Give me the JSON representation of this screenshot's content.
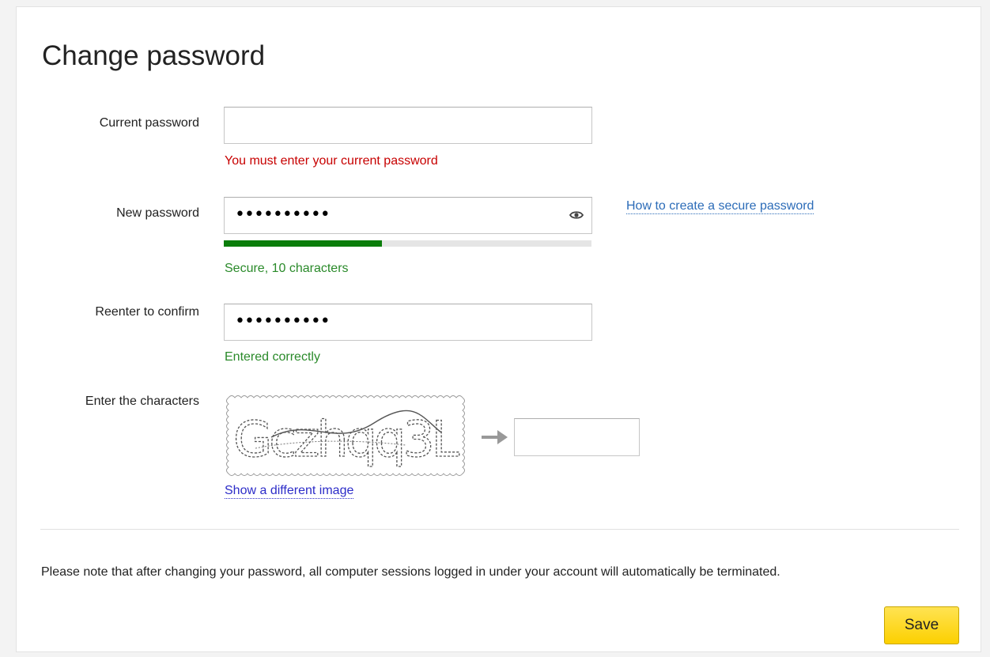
{
  "page_title": "Change password",
  "current_password": {
    "label": "Current password",
    "value": "",
    "error": "You must enter your current password"
  },
  "new_password": {
    "label": "New password",
    "masked_value": "••••••••••",
    "strength_fraction": 0.43,
    "strength_color": "#0a7d0a",
    "status": "Secure, 10 characters",
    "help_link": "How to create a secure password"
  },
  "confirm_password": {
    "label": "Reenter to confirm",
    "masked_value": "••••••••••",
    "status": "Entered correctly"
  },
  "captcha": {
    "label": "Enter the characters",
    "image_text": "Gczhqq3L",
    "value": "",
    "refresh_link": "Show a different image"
  },
  "note": "Please note that after changing your password, all computer sessions logged in under your account will automatically be terminated.",
  "save_label": "Save",
  "colors": {
    "error": "#c70000",
    "success": "#2a8a2a",
    "link": "#2c6cb8",
    "button": "#fcd000"
  },
  "icons": {
    "show_password": "eye-icon",
    "captcha_arrow": "arrow-right-icon"
  }
}
